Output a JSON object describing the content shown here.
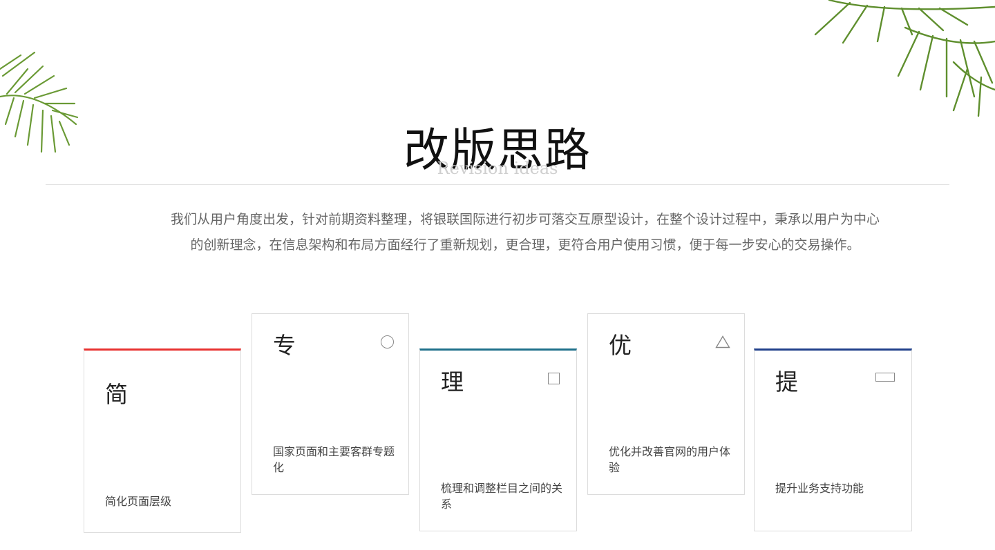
{
  "header": {
    "title": "改版思路",
    "subtitle": "Revision ideas"
  },
  "intro": {
    "line1": "我们从用户角度出发，针对前期资料整理，将银联国际进行初步可落交互原型设计，在整个设计过程中，秉承以用户为中心",
    "line2": "的创新理念，在信息架构和布局方面经行了重新规划，更合理，更符合用户使用习惯，便于每一步安心的交易操作。"
  },
  "cards": [
    {
      "title": "简",
      "desc": "简化页面层级",
      "accent": "#e8312f"
    },
    {
      "title": "专",
      "desc": "国家页面和主要客群专题化",
      "icon": "circle-icon"
    },
    {
      "title": "理",
      "desc": "梳理和调整栏目之间的关系",
      "icon": "square-icon",
      "accent": "#1d6f8a"
    },
    {
      "title": "优",
      "desc": "优化并改善官网的用户体验",
      "icon": "triangle-icon"
    },
    {
      "title": "提",
      "desc": "提升业务支持功能",
      "icon": "rectangle-icon",
      "accent": "#1f3f8a"
    }
  ],
  "colors": {
    "leaf": "#5f8f2e",
    "shape_outline": "#888888"
  }
}
